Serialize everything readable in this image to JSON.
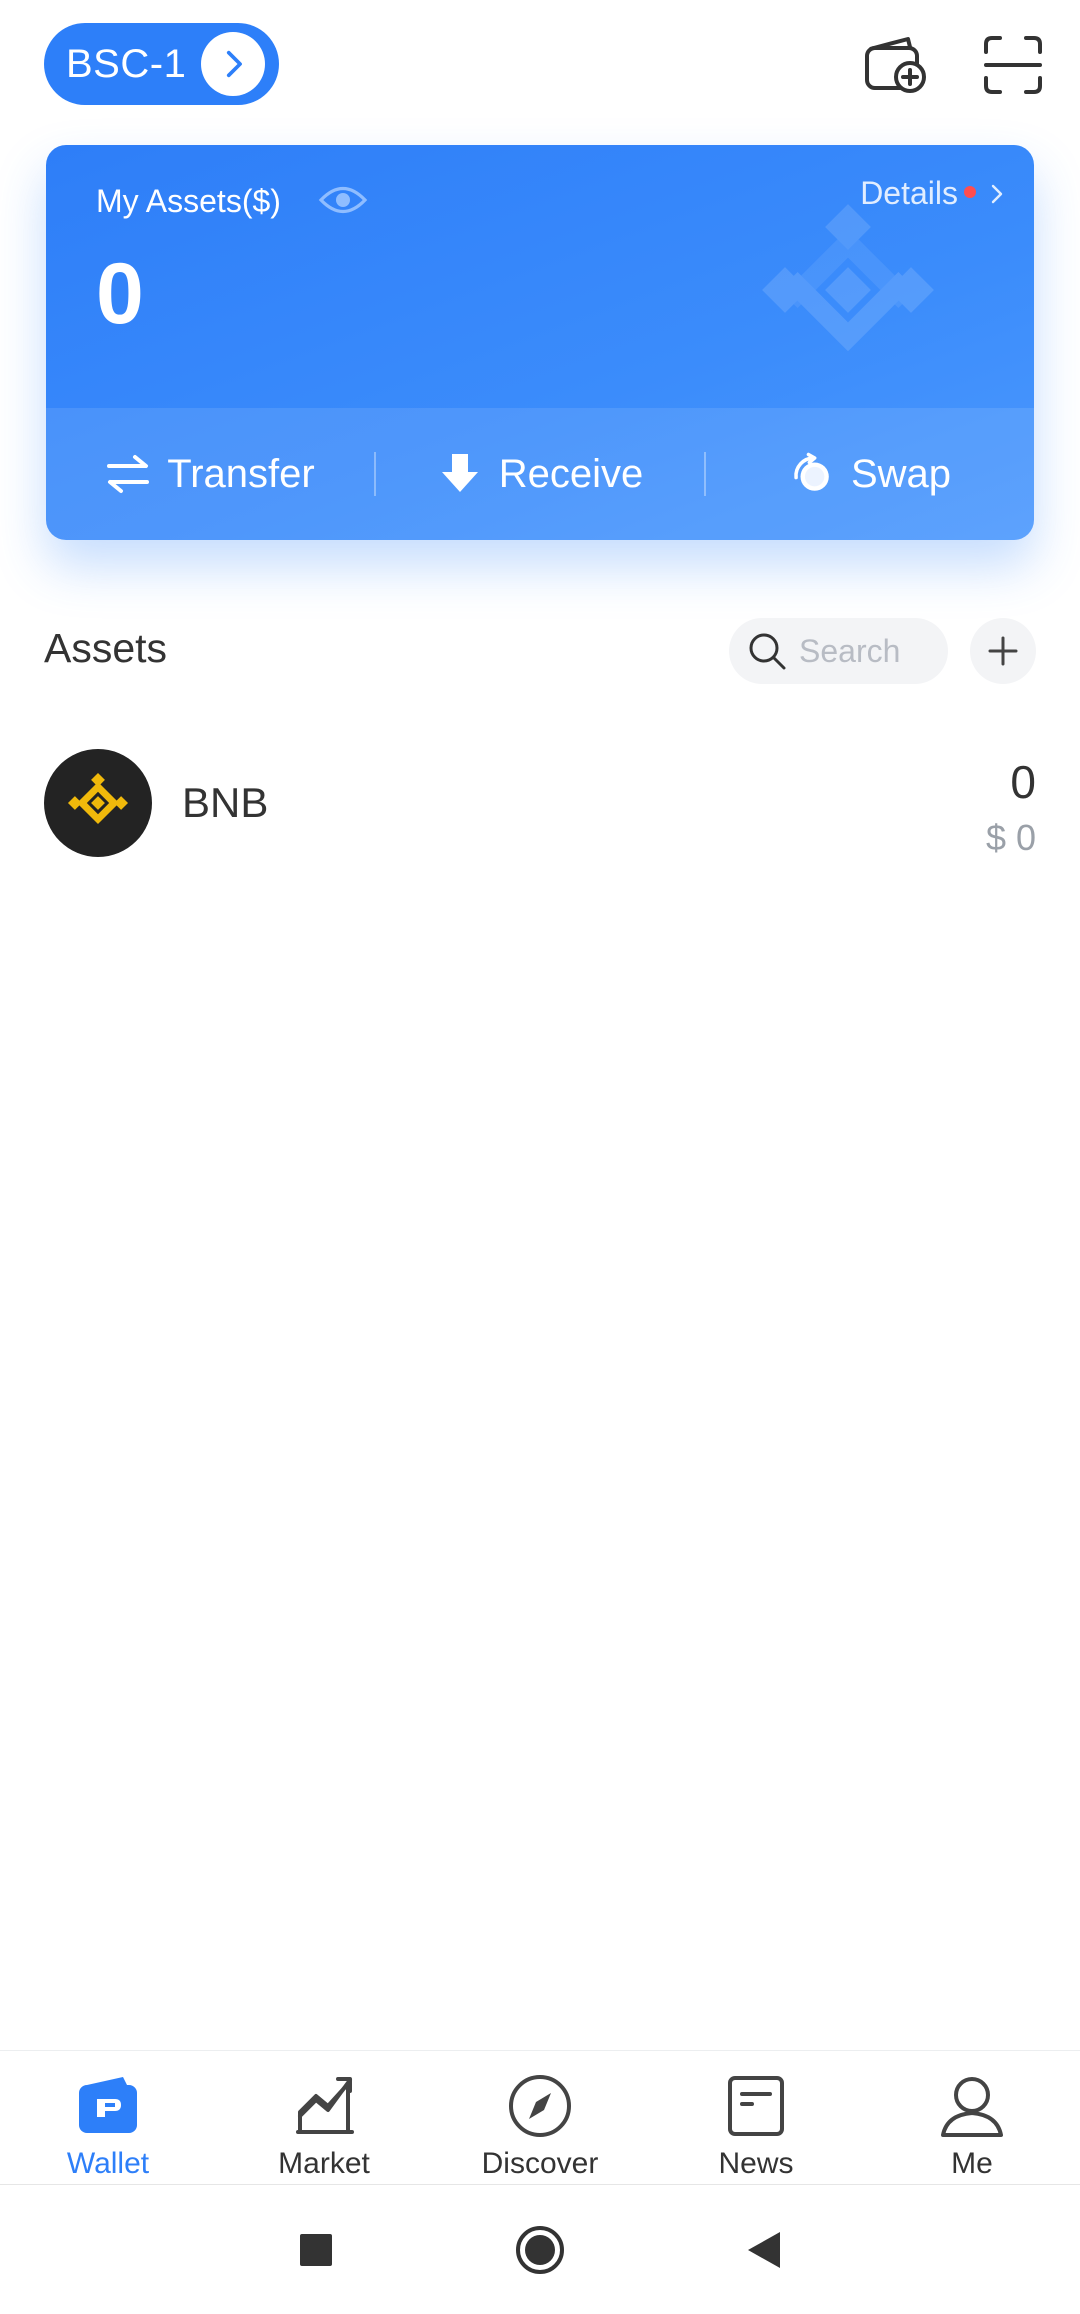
{
  "header": {
    "wallet_name": "BSC-1",
    "icons": [
      "wallet-add-icon",
      "scan-icon"
    ]
  },
  "assets_card": {
    "title": "My Assets($)",
    "total": "0",
    "details_label": "Details",
    "actions": [
      {
        "label": "Transfer",
        "icon": "transfer-icon"
      },
      {
        "label": "Receive",
        "icon": "receive-icon"
      },
      {
        "label": "Swap",
        "icon": "swap-icon"
      }
    ]
  },
  "assets": {
    "section_title": "Assets",
    "search_placeholder": "Search",
    "tokens": [
      {
        "symbol": "BNB",
        "amount": "0",
        "value": "$ 0"
      }
    ]
  },
  "bottom_nav": [
    {
      "label": "Wallet",
      "active": true
    },
    {
      "label": "Market",
      "active": false
    },
    {
      "label": "Discover",
      "active": false
    },
    {
      "label": "News",
      "active": false
    },
    {
      "label": "Me",
      "active": false
    }
  ],
  "colors": {
    "accent": "#2d7ff9",
    "bnb_yellow": "#f0b90b",
    "notification_dot": "#ff4d4f"
  }
}
